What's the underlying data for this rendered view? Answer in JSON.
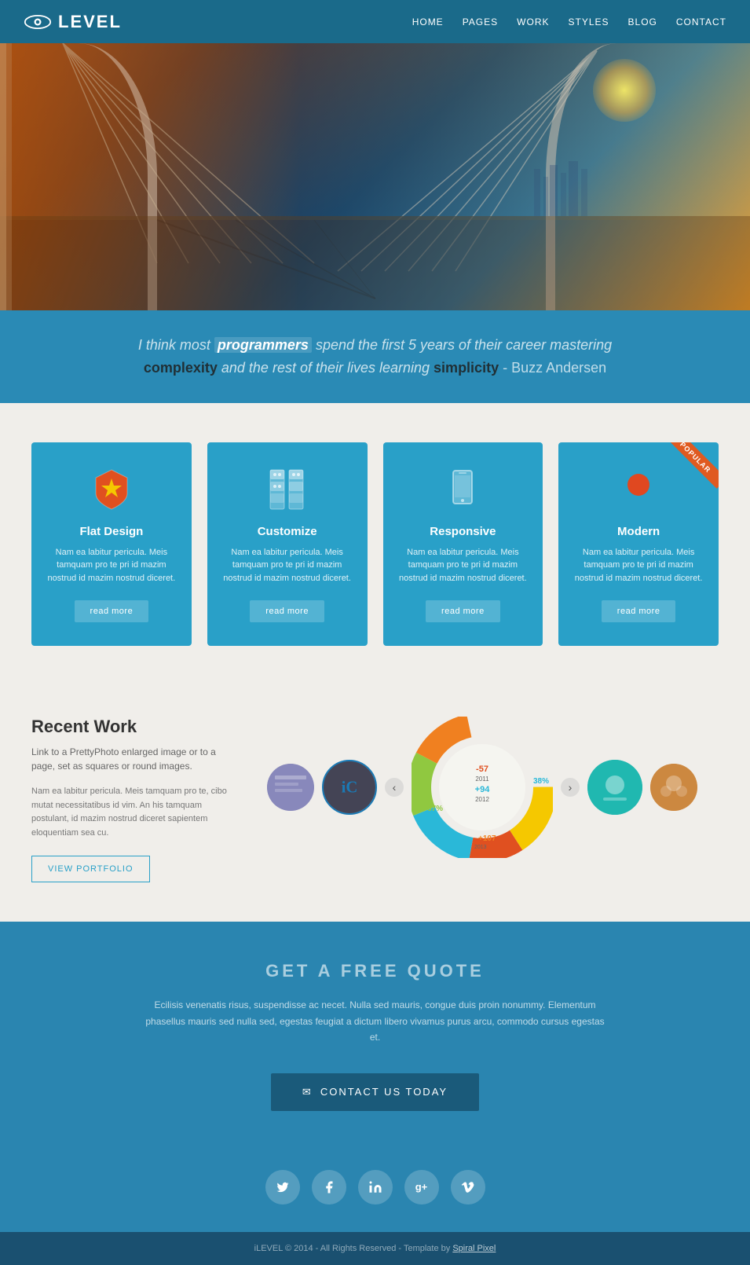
{
  "header": {
    "logo_text": "LEVEL",
    "nav": [
      {
        "label": "HOME",
        "href": "#"
      },
      {
        "label": "PAGES",
        "href": "#"
      },
      {
        "label": "WORK",
        "href": "#"
      },
      {
        "label": "STYLES",
        "href": "#"
      },
      {
        "label": "BLOG",
        "href": "#"
      },
      {
        "label": "CONTACT",
        "href": "#"
      }
    ]
  },
  "quote": {
    "prefix": "I think most ",
    "highlight": "programmers",
    "middle": " spend the first 5 years of their career mastering",
    "bold1": "complexity",
    "middle2": "and the rest of their lives learning ",
    "bold2": "simplicity",
    "author": " - Buzz Andersen"
  },
  "features": [
    {
      "id": "flat-design",
      "title": "Flat Design",
      "desc": "Nam ea labitur pericula. Meis tamquam pro te pri id mazim nostrud id mazim nostrud diceret.",
      "read_more": "read\nmore",
      "popular": false
    },
    {
      "id": "customize",
      "title": "Customize",
      "desc": "Nam ea labitur pericula. Meis tamquam pro te pri id mazim nostrud id mazim nostrud diceret.",
      "read_more": "read\nmore",
      "popular": false
    },
    {
      "id": "responsive",
      "title": "Responsive",
      "desc": "Nam ea labitur pericula. Meis tamquam pro te pri id mazim nostrud id mazim nostrud diceret.",
      "read_more": "read\nmore",
      "popular": false
    },
    {
      "id": "modern",
      "title": "Modern",
      "desc": "Nam ea labitur pericula. Meis tamquam pro te pri id mazim nostrud id mazim nostrud diceret.",
      "read_more": "read\nmore",
      "popular": true
    }
  ],
  "recent_work": {
    "title": "Recent Work",
    "subtitle": "Link to a PrettyPhoto enlarged image or to a page, set as squares or round images.",
    "desc": "Nam ea labitur pericula. Meis tamquam pro te, cibo mutat necessitatibus id vim. An his tamquam postulant, id mazim nostrud diceret sapientem eloquentiam sea cu.",
    "view_portfolio_btn": "VIEW PORTFOLIO"
  },
  "free_quote": {
    "title": "GET A FREE QUOTE",
    "desc": "Ecilisis venenatis risus, suspendisse ac necet. Nulla sed mauris, congue duis proin nonummy. Elementum phasellus mauris sed nulla sed, egestas feugiat a dictum libero vivamus purus arcu, commodo cursus egestas et.",
    "contact_btn": "CONTACT US TODAY"
  },
  "social": {
    "icons": [
      {
        "name": "twitter",
        "symbol": "𝕋"
      },
      {
        "name": "facebook",
        "symbol": "f"
      },
      {
        "name": "linkedin",
        "symbol": "in"
      },
      {
        "name": "google-plus",
        "symbol": "g+"
      },
      {
        "name": "vimeo",
        "symbol": "V"
      }
    ]
  },
  "footer": {
    "text": "iLEVEL © 2014 - All Rights Reserved - Template by",
    "link_text": "Spiral Pixel"
  },
  "colors": {
    "header_bg": "#1a6a8a",
    "quote_bg": "#2a8ab5",
    "feature_card": "#29a0c8",
    "popular_badge": "#e05a20",
    "cta_bg": "#2a85b0",
    "footer_bg": "#1a5070"
  }
}
